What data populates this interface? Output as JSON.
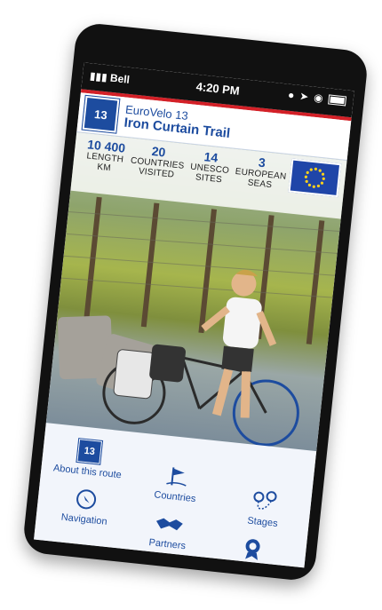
{
  "status_bar": {
    "carrier": "Bell",
    "time": "4:20 PM"
  },
  "header": {
    "route_number": "13",
    "subtitle": "EuroVelo 13",
    "title": "Iron Curtain Trail"
  },
  "stats": [
    {
      "value": "10 400",
      "label": "LENGTH KM"
    },
    {
      "value": "20",
      "label": "COUNTRIES VISITED"
    },
    {
      "value": "14",
      "label": "UNESCO SITES"
    },
    {
      "value": "3",
      "label": "EUROPEAN SEAS"
    }
  ],
  "menu": {
    "about": "About this route",
    "countries": "Countries",
    "stages": "Stages",
    "navigation": "Navigation",
    "partners": "Partners",
    "rewards": "Rewards"
  },
  "colors": {
    "brand_blue": "#1d4c9f",
    "accent_red": "#d32027"
  },
  "icons": {
    "route_badge": "route-13-badge-icon",
    "countries": "flag-icon",
    "stages": "map-pins-icon",
    "navigation": "compass-icon",
    "partners": "handshake-icon",
    "rewards": "medal-icon"
  }
}
